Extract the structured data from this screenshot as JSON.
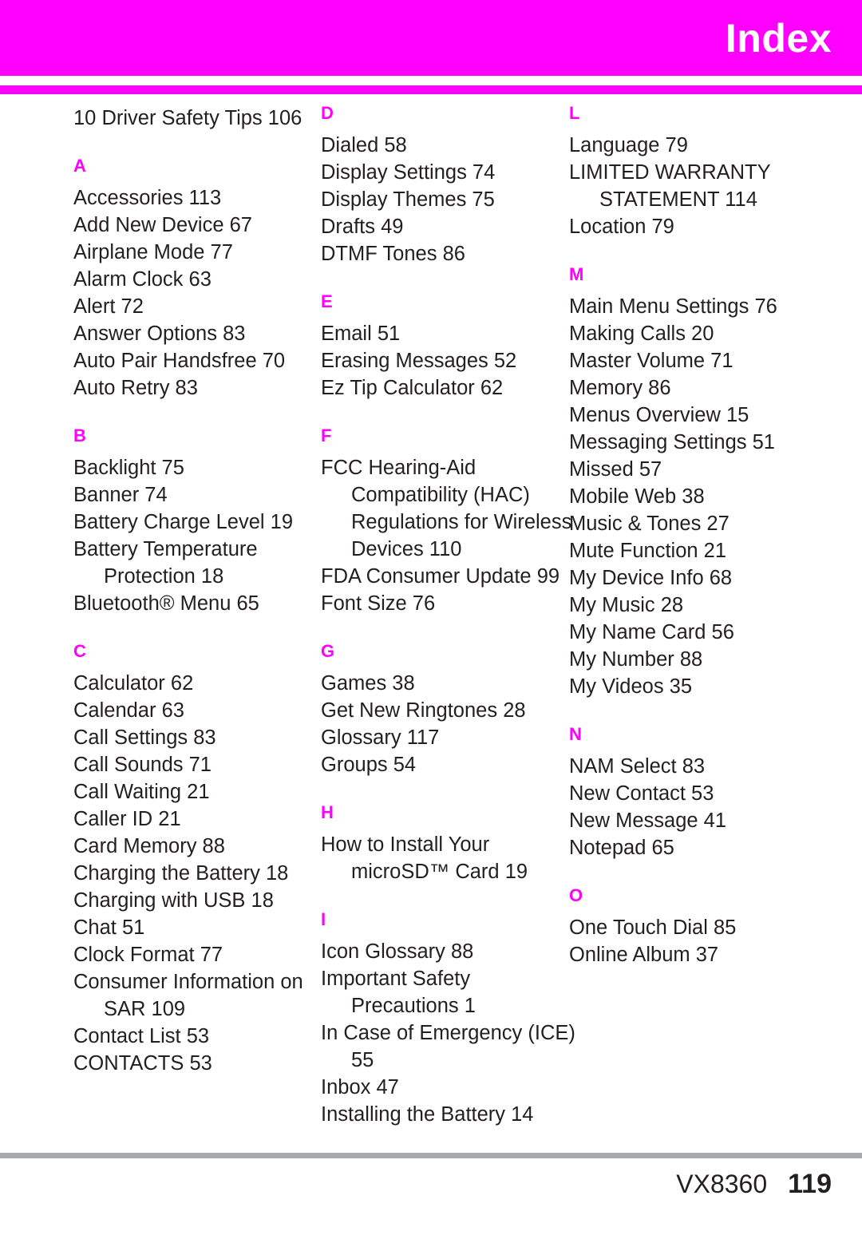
{
  "header": {
    "title": "Index",
    "band_color": "#ff00ff",
    "title_color": "#ffffff"
  },
  "accent_color": "#ff00ff",
  "text_color": "#231f20",
  "rule_color": "#a7a9ac",
  "columns": [
    {
      "name": "column-1",
      "blocks": [
        {
          "type": "entries",
          "lines": [
            {
              "text": "10 Driver Safety Tips 106",
              "indent": false
            }
          ]
        },
        {
          "type": "letter",
          "letter": "A"
        },
        {
          "type": "entries",
          "lines": [
            {
              "text": "Accessories 113",
              "indent": false
            },
            {
              "text": "Add New Device 67",
              "indent": false
            },
            {
              "text": "Airplane Mode 77",
              "indent": false
            },
            {
              "text": "Alarm Clock 63",
              "indent": false
            },
            {
              "text": "Alert 72",
              "indent": false
            },
            {
              "text": "Answer Options 83",
              "indent": false
            },
            {
              "text": "Auto Pair Handsfree 70",
              "indent": false
            },
            {
              "text": "Auto Retry 83",
              "indent": false
            }
          ]
        },
        {
          "type": "letter",
          "letter": "B"
        },
        {
          "type": "entries",
          "lines": [
            {
              "text": "Backlight 75",
              "indent": false
            },
            {
              "text": "Banner 74",
              "indent": false
            },
            {
              "text": "Battery Charge Level 19",
              "indent": false
            },
            {
              "text": "Battery Temperature",
              "indent": false
            },
            {
              "text": "Protection 18",
              "indent": true
            },
            {
              "text": "Bluetooth® Menu 65",
              "indent": false
            }
          ]
        },
        {
          "type": "letter",
          "letter": "C"
        },
        {
          "type": "entries",
          "lines": [
            {
              "text": "Calculator 62",
              "indent": false
            },
            {
              "text": "Calendar 63",
              "indent": false
            },
            {
              "text": "Call Settings 83",
              "indent": false
            },
            {
              "text": "Call Sounds 71",
              "indent": false
            },
            {
              "text": "Call Waiting 21",
              "indent": false
            },
            {
              "text": "Caller ID 21",
              "indent": false
            },
            {
              "text": "Card Memory 88",
              "indent": false
            },
            {
              "text": "Charging the Battery 18",
              "indent": false
            },
            {
              "text": "Charging with USB 18",
              "indent": false
            },
            {
              "text": "Chat 51",
              "indent": false
            },
            {
              "text": "Clock Format 77",
              "indent": false
            },
            {
              "text": "Consumer Information on",
              "indent": false
            },
            {
              "text": "SAR 109",
              "indent": true
            },
            {
              "text": "Contact List 53",
              "indent": false
            },
            {
              "text": "CONTACTS 53",
              "indent": false
            }
          ]
        }
      ]
    },
    {
      "name": "column-2",
      "blocks": [
        {
          "type": "letter-first",
          "letter": "D"
        },
        {
          "type": "entries",
          "lines": [
            {
              "text": "Dialed 58",
              "indent": false
            },
            {
              "text": "Display Settings 74",
              "indent": false
            },
            {
              "text": "Display Themes 75",
              "indent": false
            },
            {
              "text": "Drafts 49",
              "indent": false
            },
            {
              "text": "DTMF Tones 86",
              "indent": false
            }
          ]
        },
        {
          "type": "letter",
          "letter": "E"
        },
        {
          "type": "entries",
          "lines": [
            {
              "text": "Email 51",
              "indent": false
            },
            {
              "text": "Erasing Messages 52",
              "indent": false
            },
            {
              "text": "Ez Tip Calculator 62",
              "indent": false
            }
          ]
        },
        {
          "type": "letter",
          "letter": "F"
        },
        {
          "type": "entries",
          "lines": [
            {
              "text": "FCC Hearing-Aid",
              "indent": false
            },
            {
              "text": "Compatibility (HAC)",
              "indent": true
            },
            {
              "text": "Regulations for Wireless",
              "indent": true
            },
            {
              "text": "Devices 110",
              "indent": true
            },
            {
              "text": "FDA Consumer Update 99",
              "indent": false
            },
            {
              "text": "Font Size 76",
              "indent": false
            }
          ]
        },
        {
          "type": "letter",
          "letter": "G"
        },
        {
          "type": "entries",
          "lines": [
            {
              "text": "Games 38",
              "indent": false
            },
            {
              "text": "Get New Ringtones 28",
              "indent": false
            },
            {
              "text": "Glossary 117",
              "indent": false
            },
            {
              "text": "Groups 54",
              "indent": false
            }
          ]
        },
        {
          "type": "letter",
          "letter": "H"
        },
        {
          "type": "entries",
          "lines": [
            {
              "text": "How to Install Your",
              "indent": false
            },
            {
              "text": "microSD™ Card 19",
              "indent": true
            }
          ]
        },
        {
          "type": "letter",
          "letter": "I"
        },
        {
          "type": "entries",
          "lines": [
            {
              "text": "Icon Glossary 88",
              "indent": false
            },
            {
              "text": "Important Safety",
              "indent": false
            },
            {
              "text": "Precautions 1",
              "indent": true
            },
            {
              "text": "In Case of Emergency (ICE)",
              "indent": false
            },
            {
              "text": "55",
              "indent": true
            },
            {
              "text": "Inbox 47",
              "indent": false
            },
            {
              "text": "Installing the Battery 14",
              "indent": false
            }
          ]
        }
      ]
    },
    {
      "name": "column-3",
      "blocks": [
        {
          "type": "letter-first",
          "letter": "L"
        },
        {
          "type": "entries",
          "lines": [
            {
              "text": "Language 79",
              "indent": false
            },
            {
              "text": "LIMITED WARRANTY",
              "indent": false
            },
            {
              "text": "STATEMENT 114",
              "indent": true
            },
            {
              "text": "Location 79",
              "indent": false
            }
          ]
        },
        {
          "type": "letter",
          "letter": "M"
        },
        {
          "type": "entries",
          "lines": [
            {
              "text": "Main Menu Settings 76",
              "indent": false
            },
            {
              "text": "Making Calls 20",
              "indent": false
            },
            {
              "text": "Master Volume 71",
              "indent": false
            },
            {
              "text": "Memory 86",
              "indent": false
            },
            {
              "text": "Menus Overview 15",
              "indent": false
            },
            {
              "text": "Messaging Settings 51",
              "indent": false
            },
            {
              "text": "Missed 57",
              "indent": false
            },
            {
              "text": "Mobile Web 38",
              "indent": false
            },
            {
              "text": "Music & Tones 27",
              "indent": false
            },
            {
              "text": "Mute Function 21",
              "indent": false
            },
            {
              "text": "My Device Info 68",
              "indent": false
            },
            {
              "text": "My Music 28",
              "indent": false
            },
            {
              "text": "My Name Card 56",
              "indent": false
            },
            {
              "text": "My Number 88",
              "indent": false
            },
            {
              "text": "My Videos 35",
              "indent": false
            }
          ]
        },
        {
          "type": "letter",
          "letter": "N"
        },
        {
          "type": "entries",
          "lines": [
            {
              "text": "NAM Select 83",
              "indent": false
            },
            {
              "text": "New Contact 53",
              "indent": false
            },
            {
              "text": "New Message 41",
              "indent": false
            },
            {
              "text": "Notepad 65",
              "indent": false
            }
          ]
        },
        {
          "type": "letter",
          "letter": "O"
        },
        {
          "type": "entries",
          "lines": [
            {
              "text": "One Touch Dial 85",
              "indent": false
            },
            {
              "text": "Online Album 37",
              "indent": false
            }
          ]
        }
      ]
    }
  ],
  "footer": {
    "model": "VX8360",
    "page_number": "119"
  }
}
